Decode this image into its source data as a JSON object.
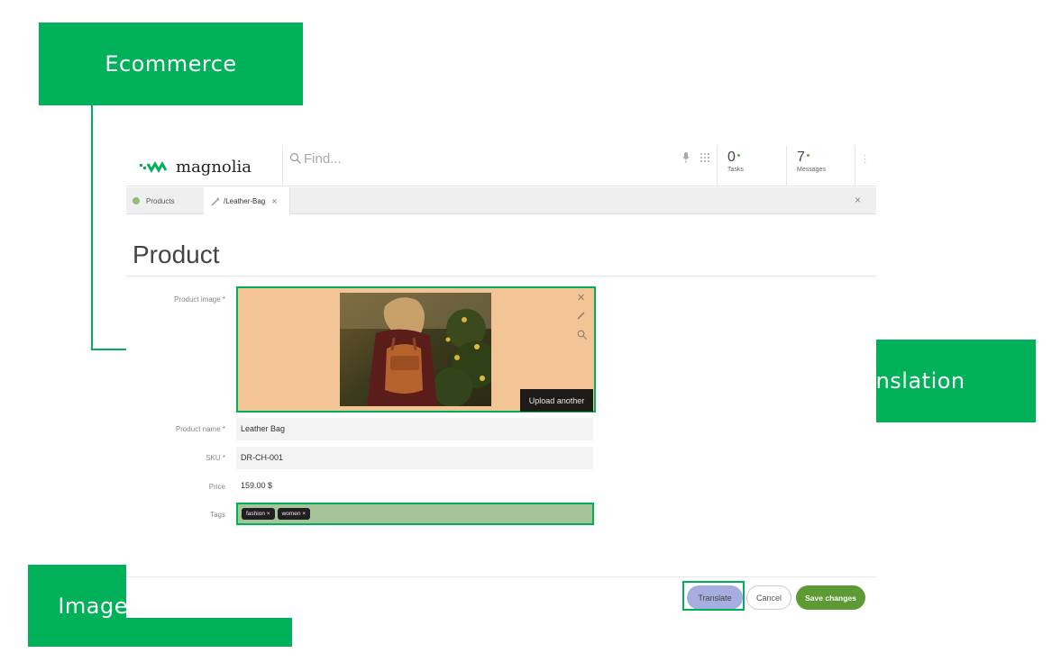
{
  "callouts": {
    "ecommerce": "Ecommerce",
    "translation": "Translation",
    "image_recognition": "Image recognition"
  },
  "colors": {
    "accent": "#00b159",
    "brand": "#5e9a33",
    "translate": "#a5aede"
  },
  "header": {
    "logo_text": "magnolia",
    "search_placeholder": "Find...",
    "tasks_count": "0",
    "tasks_label": "Tasks",
    "messages_count": "7",
    "messages_label": "Messages"
  },
  "tabs": [
    {
      "label": "Products",
      "icon": "app-dot-icon"
    },
    {
      "label": "/Leather-Bag",
      "icon": "pencil-icon",
      "active": true
    }
  ],
  "page": {
    "title": "Product"
  },
  "form": {
    "image_label": "Product image *",
    "upload_label": "Upload another",
    "name_label": "Product name *",
    "name_value": "Leather Bag",
    "sku_label": "SKU *",
    "sku_value": "DR-CH-001",
    "price_label": "Price",
    "price_value": "159.00 $",
    "tags_label": "Tags",
    "tags": [
      "fashion ×",
      "women ×"
    ]
  },
  "footer": {
    "translate": "Translate",
    "cancel": "Cancel",
    "save": "Save changes"
  }
}
